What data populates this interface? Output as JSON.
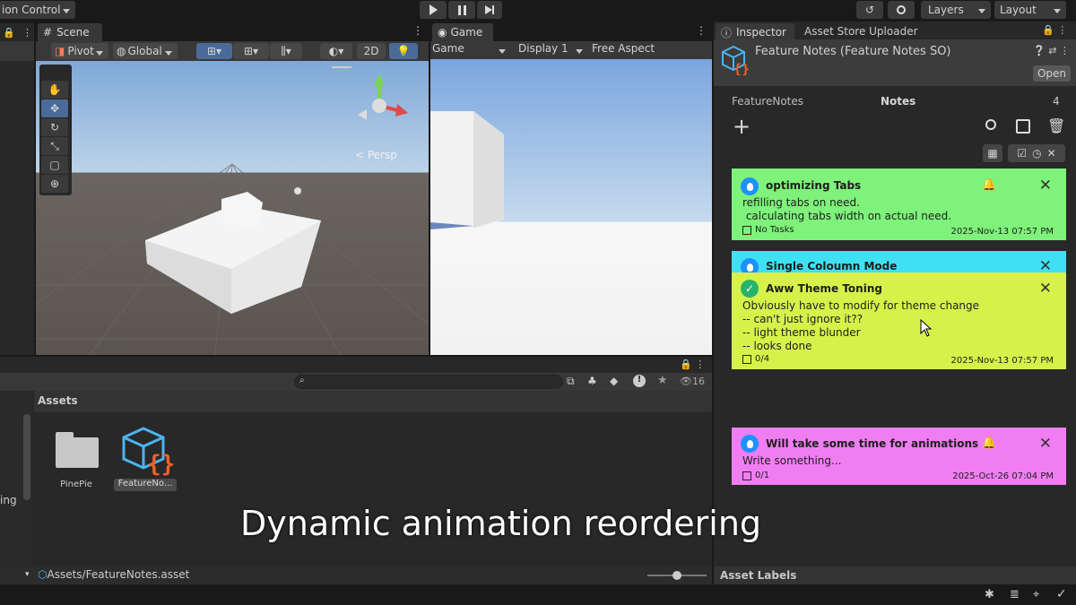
{
  "toolbar": {
    "version_control": "ion Control",
    "layers": "Layers",
    "layout": "Layout"
  },
  "scene": {
    "tab": "Scene",
    "pivot": "Pivot",
    "global": "Global",
    "btn_2d": "2D",
    "persp": "< Persp"
  },
  "game": {
    "tab": "Game",
    "game_dd": "Game",
    "display": "Display 1",
    "aspect": "Free Aspect"
  },
  "inspector": {
    "tab": "Inspector",
    "tab2": "Asset Store Uploader",
    "object_title": "Feature Notes (Feature Notes SO)",
    "open": "Open",
    "section_left": "FeatureNotes",
    "section_center": "Notes",
    "count": "4",
    "asset_labels": "Asset Labels"
  },
  "notes": [
    {
      "title": "optimizing Tabs",
      "body": "refilling tabs on need.\n calculating tabs width on actual need.",
      "tasks": "No Tasks",
      "date": "2025-Nov-13 07:57 PM",
      "color": "#7ef27a"
    },
    {
      "title": "Single Coloumn Mode",
      "color": "#3fe0f2"
    },
    {
      "title": "Aww Theme Toning",
      "body": "Obviously have to modify for theme change\n-- can't just ignore it??\n-- light theme blunder\n-- looks done",
      "tasks": "0/4",
      "date": "2025-Nov-13 07:57 PM",
      "color": "#d6f24a"
    },
    {
      "title": "Will take some time for animations",
      "body": "Write something...",
      "tasks": "0/1",
      "date": "2025-Oct-26 07:04 PM",
      "color": "#f07ef2"
    }
  ],
  "project": {
    "assets_header": "Assets",
    "visible_count": "16",
    "items": [
      "PinePie",
      "FeatureNo..."
    ],
    "path": "Assets/FeatureNotes.asset",
    "left_frag": "ing"
  },
  "caption": "Dynamic animation reordering",
  "icons": {
    "play": "play-icon",
    "pause": "pause-icon",
    "step": "step-icon",
    "search": "search-icon",
    "lock": "lock-icon"
  }
}
